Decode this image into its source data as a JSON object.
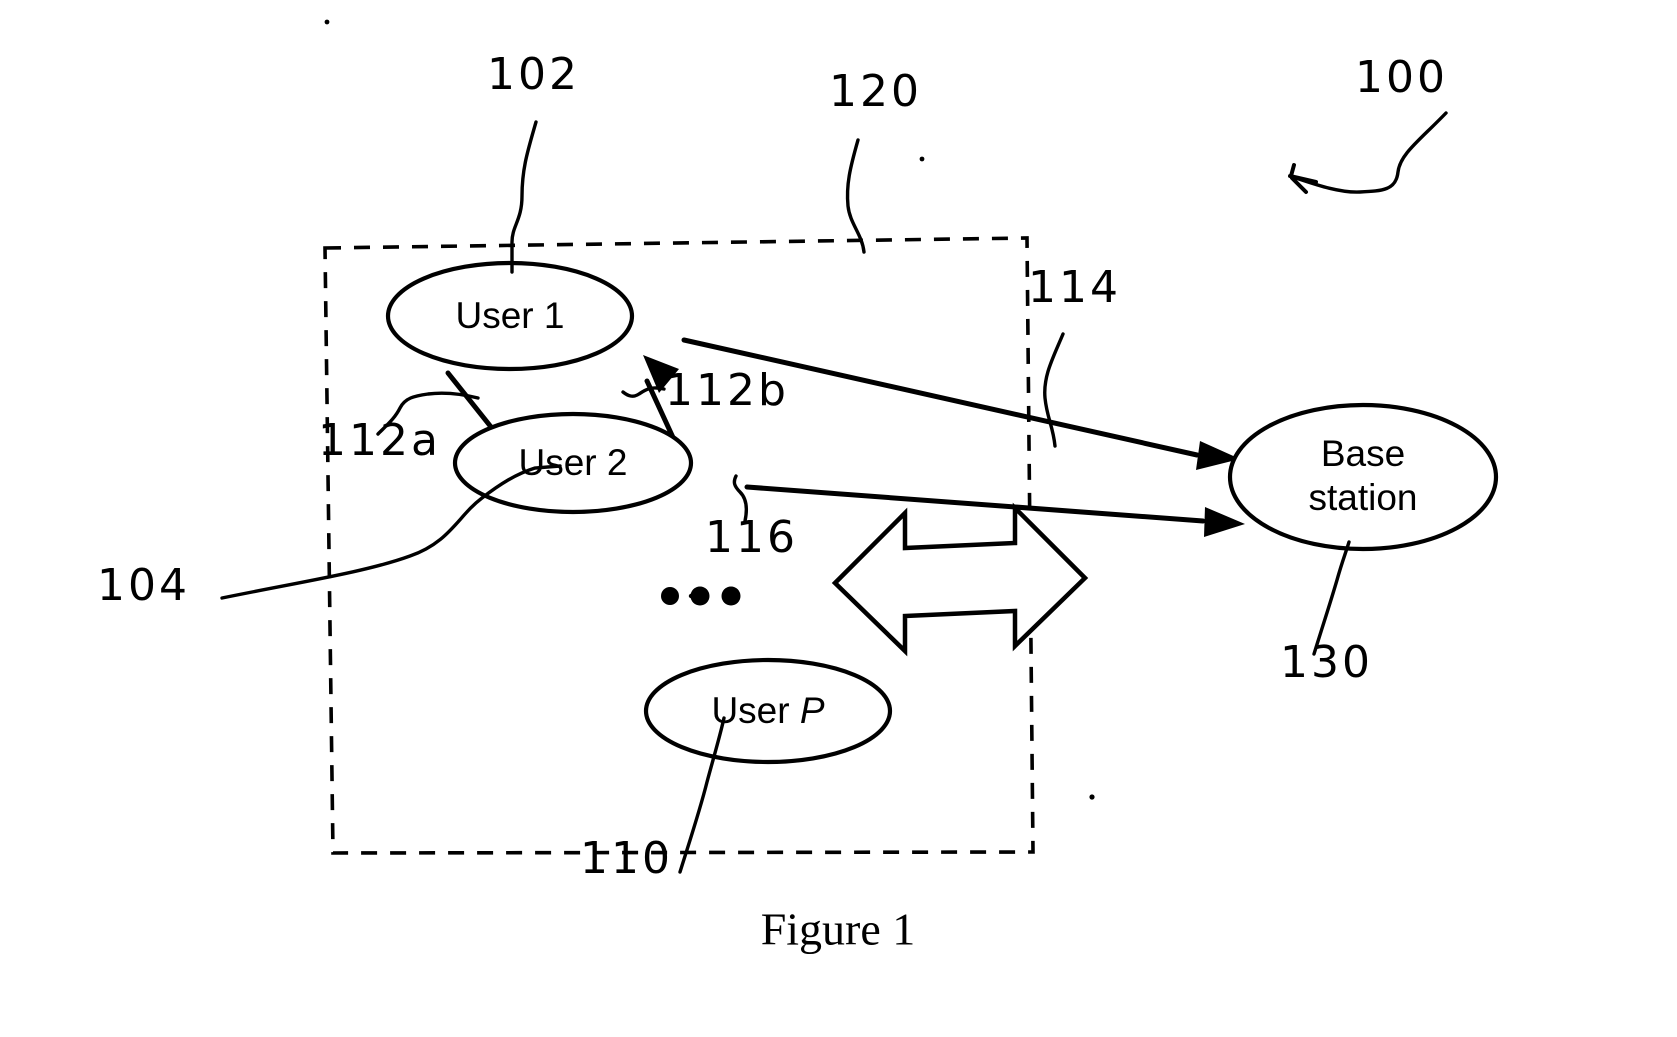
{
  "figure": {
    "caption": "Figure 1",
    "system_ref": "100"
  },
  "nodes": [
    {
      "id": "user1",
      "label": "User 1",
      "ref": "102",
      "italic_tail": false
    },
    {
      "id": "user2",
      "label": "User 2",
      "ref": "104",
      "italic_tail": false
    },
    {
      "id": "userp",
      "label_head": "User ",
      "label_tail": "P",
      "ref": "110",
      "italic_tail": true
    },
    {
      "id": "base",
      "label_line1": "Base",
      "label_line2": "station",
      "ref": "130"
    }
  ],
  "region": {
    "name": "user-group-region",
    "ref": "120"
  },
  "links": [
    {
      "id": "interuser-down",
      "ref": "112a",
      "from": "user1",
      "to": "user2"
    },
    {
      "id": "interuser-up",
      "ref": "112b",
      "from": "user2",
      "to": "user1"
    },
    {
      "id": "user1-to-base",
      "ref": "114",
      "from": "user1",
      "to": "base"
    },
    {
      "id": "user2-to-base",
      "ref": "116",
      "from": "user2",
      "to": "base"
    }
  ],
  "ellipsis": "• • •",
  "refs": {
    "r100": "100",
    "r102": "102",
    "r104": "104",
    "r110": "110",
    "r112a": "112a",
    "r112b": "112b",
    "r114": "114",
    "r116": "116",
    "r120": "120",
    "r130": "130"
  },
  "labels": {
    "user1": "User 1",
    "user2": "User 2",
    "userp_head": "User ",
    "userp_tail": "P",
    "base_line1": "Base",
    "base_line2": "station",
    "caption": "Figure 1"
  },
  "colors": {
    "ink": "#000000",
    "paper": "#ffffff"
  }
}
